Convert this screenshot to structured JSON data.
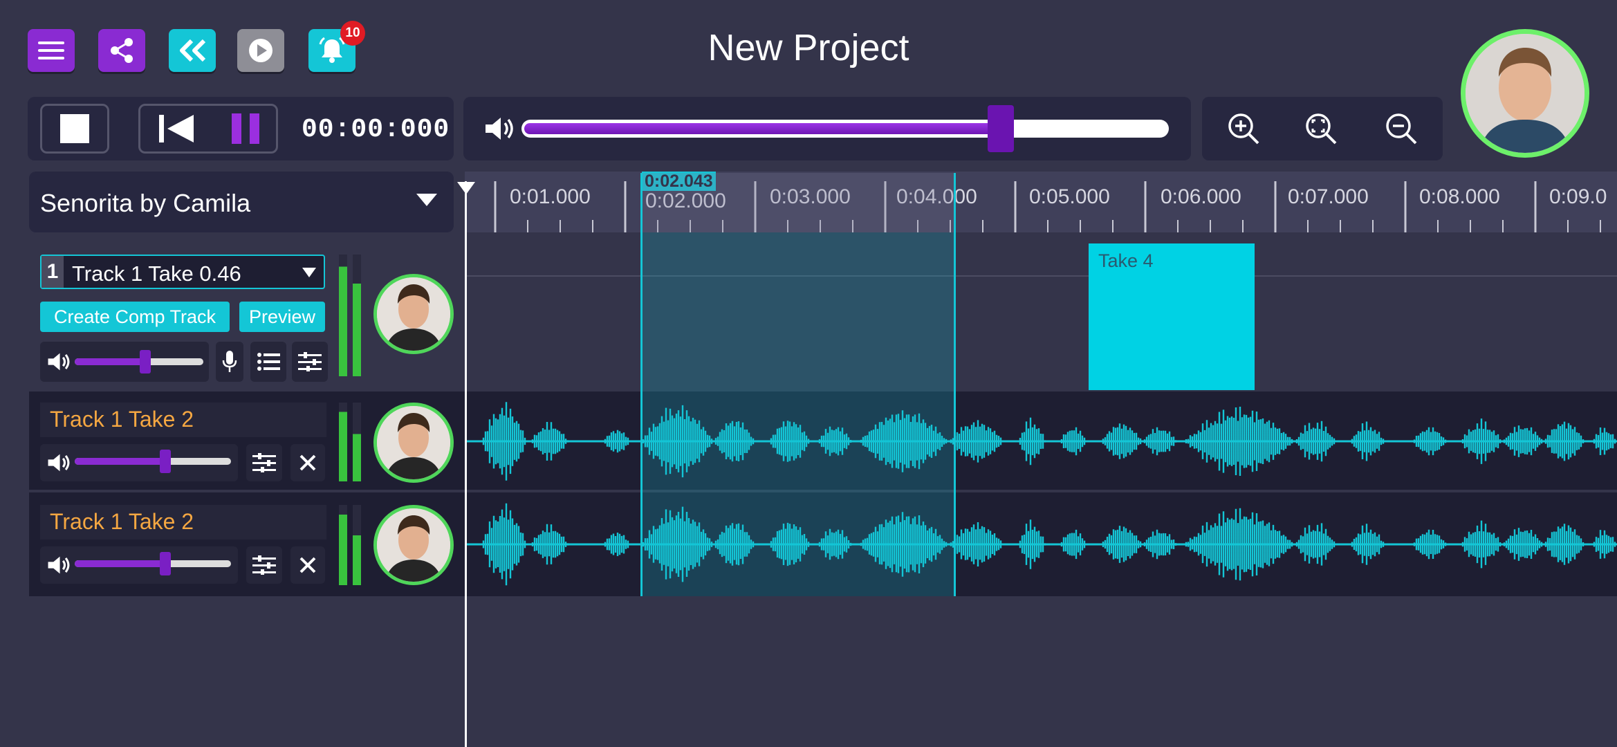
{
  "app": {
    "title": "New Project"
  },
  "toolbar": {
    "notification_count": "10",
    "icons": [
      "menu-icon",
      "share-icon",
      "rewind-icon",
      "play-icon",
      "bell-icon"
    ],
    "colors": {
      "purple": "#8a2bd2",
      "cyan": "#14c6d6",
      "grey": "#8e8e96",
      "badge": "#e01b24"
    }
  },
  "transport": {
    "time": "00:00:000"
  },
  "volume": {
    "master_level": 0.74
  },
  "song": {
    "name": "Senorita by Camila"
  },
  "ruler": {
    "labels": [
      "0:01.000",
      "0:02.000",
      "0:03.000",
      "0:04.000",
      "0:05.000",
      "0:06.000",
      "0:07.000",
      "0:08.000",
      "0:09.0"
    ],
    "selection_start": "0:02.043"
  },
  "tracks": [
    {
      "number": "1",
      "name": "Track 1 Take 0.46",
      "level": 0.55,
      "create_comp_label": "Create Comp Track",
      "preview_label": "Preview",
      "clip_label": "Take 4"
    },
    {
      "name": "Track 1 Take 2",
      "level": 0.58
    },
    {
      "name": "Track 1 Take 2",
      "level": 0.58
    }
  ]
}
